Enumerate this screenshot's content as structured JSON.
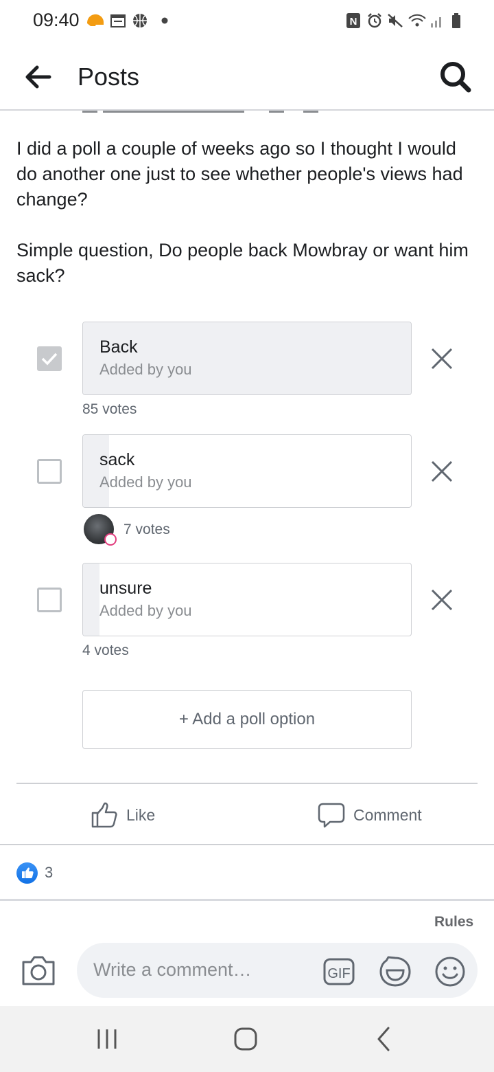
{
  "status_bar": {
    "time": "09:40",
    "left_icons": [
      "helmet-notification-icon",
      "calendar-icon",
      "basketball-icon",
      "dot-icon"
    ],
    "right_icons": [
      "nfc-icon",
      "alarm-icon",
      "mute-icon",
      "wifi-icon",
      "signal-icon",
      "battery-icon"
    ]
  },
  "header": {
    "title": "Posts",
    "back_icon": "back-arrow-icon",
    "search_icon": "search-icon"
  },
  "post": {
    "paragraph_1": "I did a poll a couple of weeks ago so I thought I would do another one just to see whether people's views had change?",
    "paragraph_2": "Simple question, Do people back Mowbray or want him sack?"
  },
  "poll": {
    "options": [
      {
        "label": "Back",
        "added_by": "Added by you",
        "votes": "85 votes",
        "checked": true,
        "share": 1.0
      },
      {
        "label": "sack",
        "added_by": "Added by you",
        "votes": "7 votes",
        "checked": false,
        "share": 0.08
      },
      {
        "label": "unsure",
        "added_by": "Added by you",
        "votes": "4 votes",
        "checked": false,
        "share": 0.05
      }
    ],
    "add_option_label": "+ Add a poll option"
  },
  "actions": {
    "like_label": "Like",
    "comment_label": "Comment"
  },
  "reactions": {
    "count": "3"
  },
  "rules_label": "Rules",
  "comment_input": {
    "placeholder": "Write a comment…",
    "icons": [
      "gif-icon",
      "sticker-icon",
      "emoji-icon"
    ]
  },
  "colors": {
    "accent_blue": "#1877f2",
    "poll_fill": "#eff0f3",
    "border": "#ced0d4",
    "secondary_text": "#606770"
  }
}
